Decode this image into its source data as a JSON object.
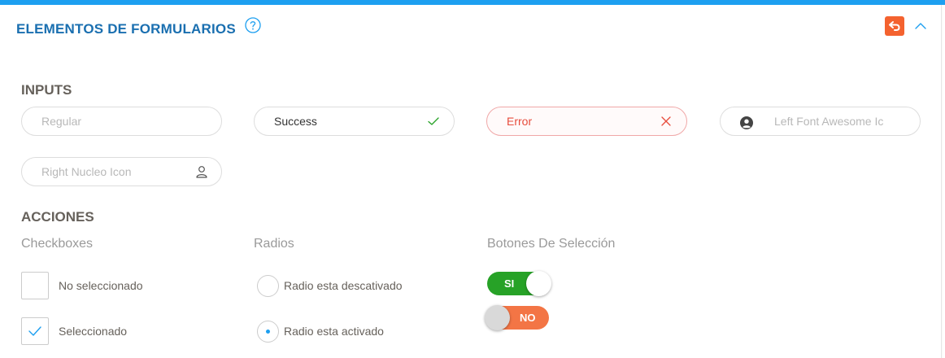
{
  "header": {
    "title": "ELEMENTOS DE FORMULARIOS",
    "help_icon": "question-circle-icon",
    "back_icon": "reply-arrow-icon",
    "collapse_icon": "chevron-up-icon"
  },
  "inputs_section": {
    "title": "INPUTS",
    "fields": {
      "regular": {
        "placeholder": "Regular",
        "value": ""
      },
      "success": {
        "placeholder": "",
        "value": "Success",
        "icon": "check-icon"
      },
      "error": {
        "placeholder": "",
        "value": "Error",
        "icon": "close-icon"
      },
      "left_icon": {
        "placeholder": "Left Font Awesome Icon",
        "value": "",
        "icon": "user-circle-icon"
      },
      "right_icon": {
        "placeholder": "Right Nucleo Icon",
        "value": "",
        "icon": "user-outline-icon"
      }
    }
  },
  "actions_section": {
    "title": "ACCIONES",
    "checkboxes": {
      "title": "Checkboxes",
      "items": [
        {
          "label": "No seleccionado",
          "checked": false
        },
        {
          "label": "Seleccionado",
          "checked": true
        }
      ]
    },
    "radios": {
      "title": "Radios",
      "items": [
        {
          "label": "Radio esta descativado",
          "selected": false
        },
        {
          "label": "Radio esta activado",
          "selected": true
        }
      ]
    },
    "switches": {
      "title": "Botones De Selección",
      "items": [
        {
          "label": "SI",
          "on": true
        },
        {
          "label": "NO",
          "on": false
        }
      ]
    }
  },
  "colors": {
    "top_bar": "#1d9ff0",
    "title": "#1a6fb0",
    "accent_orange": "#f4622f",
    "success_green": "#27a227",
    "error_red": "#e74c3c"
  }
}
